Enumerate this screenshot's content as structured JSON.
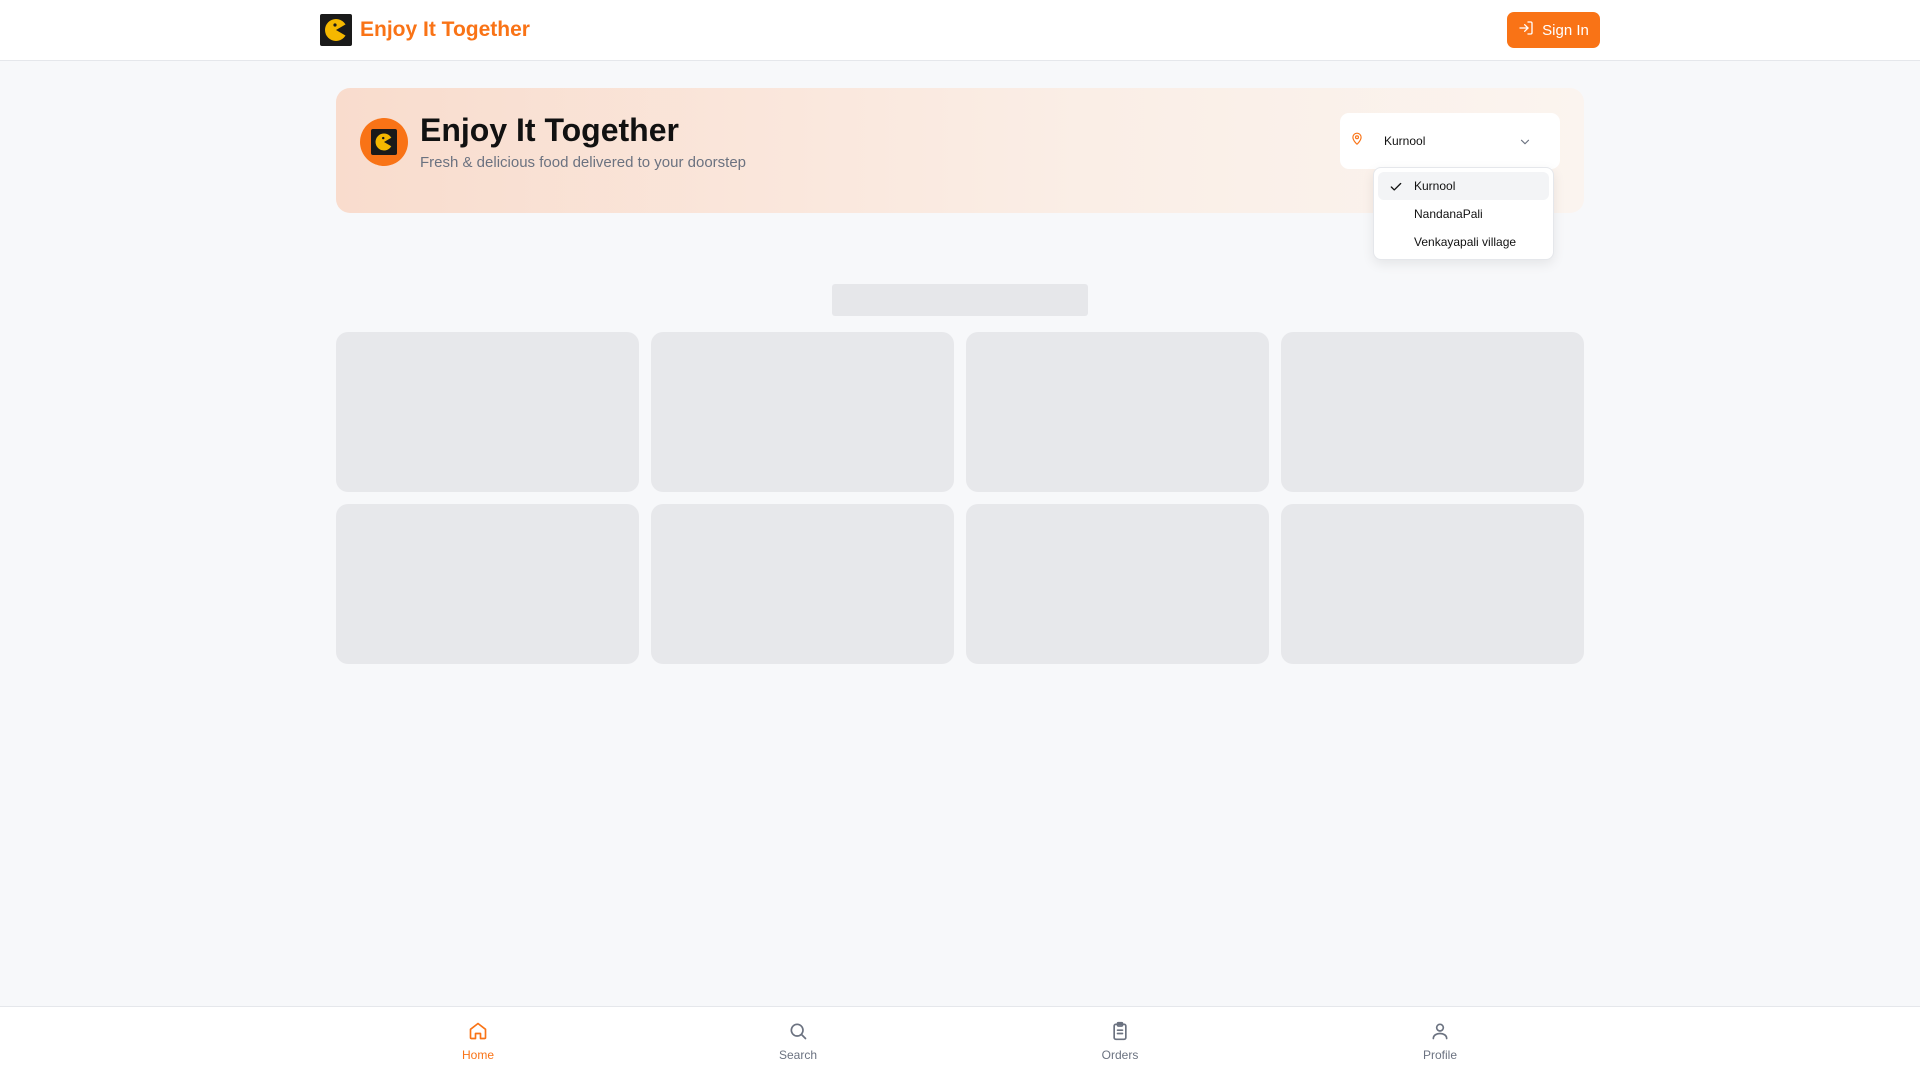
{
  "app": {
    "brand_name": "Enjoy It Together",
    "sign_in_label": "Sign In",
    "accent_color": "#f97316"
  },
  "hero": {
    "title": "Enjoy It Together",
    "subtitle": "Fresh & delicious food delivered to your doorstep"
  },
  "location": {
    "icon": "map-pin-icon",
    "selected": "Kurnool",
    "options": [
      {
        "label": "Kurnool",
        "selected": true
      },
      {
        "label": "NandanaPali",
        "selected": false
      },
      {
        "label": "Venkayapali village",
        "selected": false
      }
    ]
  },
  "bottom_nav": [
    {
      "label": "Home",
      "icon": "home-icon",
      "active": true
    },
    {
      "label": "Search",
      "icon": "search-icon",
      "active": false
    },
    {
      "label": "Orders",
      "icon": "clipboard-icon",
      "active": false
    },
    {
      "label": "Profile",
      "icon": "user-icon",
      "active": false
    }
  ]
}
